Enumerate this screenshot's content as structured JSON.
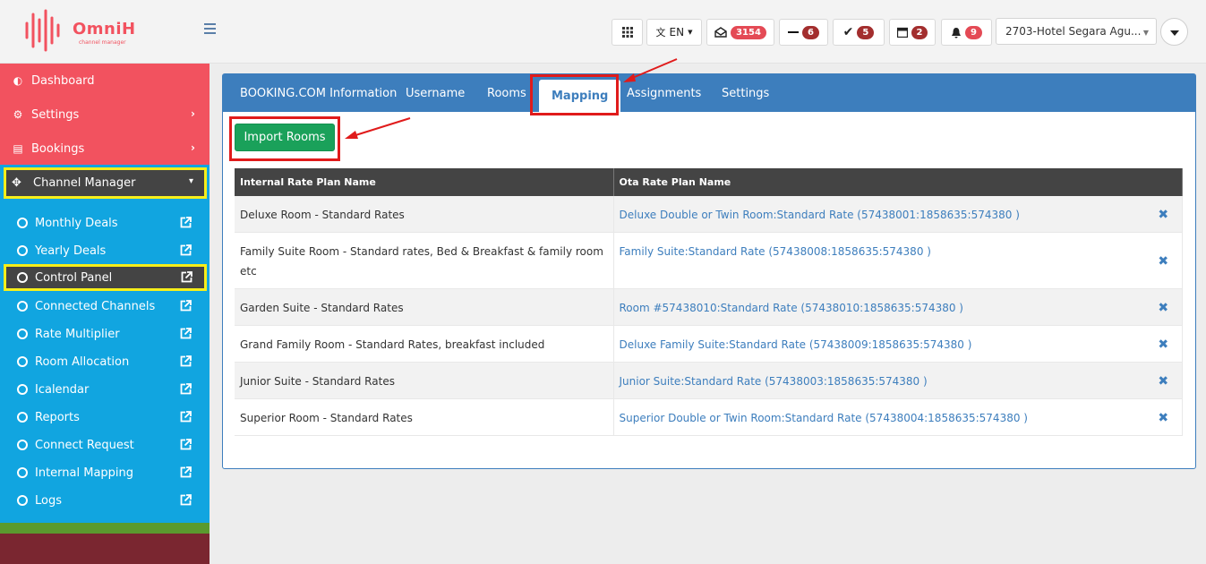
{
  "brand": {
    "name": "OmniH",
    "tagline": "channel manager"
  },
  "topbar": {
    "language": "EN",
    "messages_count": "3154",
    "minus_count": "6",
    "check_count": "5",
    "calendar_count": "2",
    "bell_count": "9",
    "hotel_selected": "2703-Hotel Segara Agu..."
  },
  "sidebar": {
    "dashboard": "Dashboard",
    "settings": "Settings",
    "bookings": "Bookings",
    "channel_manager": "Channel Manager",
    "sub_items": [
      "Monthly Deals",
      "Yearly Deals",
      "Control Panel",
      "Connected Channels",
      "Rate Multiplier",
      "Room Allocation",
      "Icalendar",
      "Reports",
      "Connect Request",
      "Internal Mapping",
      "Logs"
    ]
  },
  "tabs": [
    "BOOKING.COM Information",
    "Username",
    "Rooms",
    "Mapping",
    "Assignments",
    "Settings"
  ],
  "import_button": "Import Rooms",
  "table": {
    "headers": [
      "Internal Rate Plan Name",
      "Ota Rate Plan Name"
    ],
    "rows": [
      {
        "internal": "Deluxe Room - Standard Rates",
        "ota": "Deluxe Double or Twin Room:Standard Rate (57438001:1858635:574380 )"
      },
      {
        "internal": "Family Suite Room - Standard rates, Bed & Breakfast & family room etc",
        "ota": "Family Suite:Standard Rate (57438008:1858635:574380 )"
      },
      {
        "internal": "Garden Suite - Standard Rates",
        "ota": "Room #57438010:Standard Rate (57438010:1858635:574380 )"
      },
      {
        "internal": "Grand Family Room - Standard Rates, breakfast included",
        "ota": "Deluxe Family Suite:Standard Rate (57438009:1858635:574380 )"
      },
      {
        "internal": "Junior Suite - Standard Rates",
        "ota": "Junior Suite:Standard Rate (57438003:1858635:574380 )"
      },
      {
        "internal": "Superior Room - Standard Rates",
        "ota": "Superior Double or Twin Room:Standard Rate (57438004:1858635:574380 )"
      }
    ],
    "remove_symbol": "✖"
  }
}
